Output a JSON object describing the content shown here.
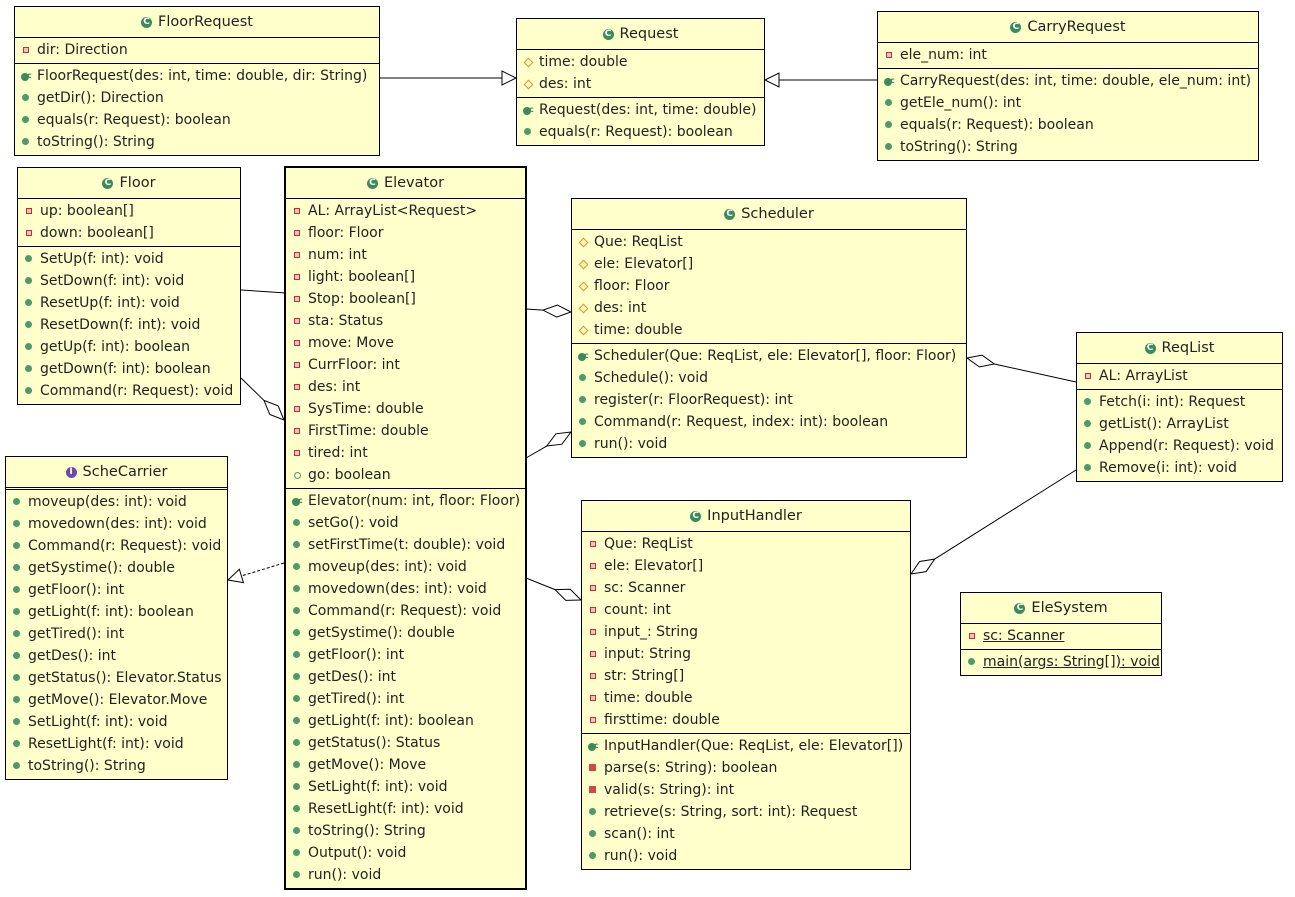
{
  "colors": {
    "class_fill": "#ffffcc",
    "border": "#000000",
    "public": "#4a9a6a",
    "private": "#c03030",
    "protected": "#c8a030",
    "interface": "#6a4aa8"
  },
  "classes": [
    {
      "id": "FloorRequest",
      "name": "FloorRequest",
      "kind": "class",
      "attributes": [
        {
          "vis": "private",
          "text": "dir: Direction"
        }
      ],
      "methods": [
        {
          "vis": "constructor",
          "text": "FloorRequest(des: int, time: double, dir: String)"
        },
        {
          "vis": "public",
          "text": "getDir(): Direction"
        },
        {
          "vis": "public",
          "text": "equals(r: Request): boolean"
        },
        {
          "vis": "public",
          "text": "toString(): String"
        }
      ]
    },
    {
      "id": "Request",
      "name": "Request",
      "kind": "class",
      "attributes": [
        {
          "vis": "protected",
          "text": "time: double"
        },
        {
          "vis": "protected",
          "text": "des: int"
        }
      ],
      "methods": [
        {
          "vis": "constructor",
          "text": "Request(des: int, time: double)"
        },
        {
          "vis": "public",
          "text": "equals(r: Request): boolean"
        }
      ]
    },
    {
      "id": "CarryRequest",
      "name": "CarryRequest",
      "kind": "class",
      "attributes": [
        {
          "vis": "private",
          "text": "ele_num: int"
        }
      ],
      "methods": [
        {
          "vis": "constructor",
          "text": "CarryRequest(des: int, time: double, ele_num: int)"
        },
        {
          "vis": "public",
          "text": "getEle_num(): int"
        },
        {
          "vis": "public",
          "text": "equals(r: Request): boolean"
        },
        {
          "vis": "public",
          "text": "toString(): String"
        }
      ]
    },
    {
      "id": "Floor",
      "name": "Floor",
      "kind": "class",
      "attributes": [
        {
          "vis": "private",
          "text": "up: boolean[]"
        },
        {
          "vis": "private",
          "text": "down: boolean[]"
        }
      ],
      "methods": [
        {
          "vis": "public",
          "text": "SetUp(f: int): void"
        },
        {
          "vis": "public",
          "text": "SetDown(f: int): void"
        },
        {
          "vis": "public",
          "text": "ResetUp(f: int): void"
        },
        {
          "vis": "public",
          "text": "ResetDown(f: int): void"
        },
        {
          "vis": "public",
          "text": "getUp(f: int): boolean"
        },
        {
          "vis": "public",
          "text": "getDown(f: int): boolean"
        },
        {
          "vis": "public",
          "text": "Command(r: Request): void"
        }
      ]
    },
    {
      "id": "Elevator",
      "name": "Elevator",
      "kind": "class",
      "selected": true,
      "attributes": [
        {
          "vis": "private",
          "text": "AL: ArrayList<Request>"
        },
        {
          "vis": "private",
          "text": "floor: Floor"
        },
        {
          "vis": "private",
          "text": "num: int"
        },
        {
          "vis": "private",
          "text": "light: boolean[]"
        },
        {
          "vis": "private",
          "text": "Stop: boolean[]"
        },
        {
          "vis": "private",
          "text": "sta: Status"
        },
        {
          "vis": "private",
          "text": "move: Move"
        },
        {
          "vis": "private",
          "text": "CurrFloor: int"
        },
        {
          "vis": "private",
          "text": "des: int"
        },
        {
          "vis": "private",
          "text": "SysTime: double"
        },
        {
          "vis": "private",
          "text": "FirstTime: double"
        },
        {
          "vis": "private",
          "text": "tired: int"
        },
        {
          "vis": "package",
          "text": "go: boolean"
        }
      ],
      "methods": [
        {
          "vis": "constructor",
          "text": "Elevator(num: int, floor: Floor)"
        },
        {
          "vis": "public",
          "text": "setGo(): void"
        },
        {
          "vis": "public",
          "text": "setFirstTime(t: double): void"
        },
        {
          "vis": "public",
          "text": "moveup(des: int): void"
        },
        {
          "vis": "public",
          "text": "movedown(des: int): void"
        },
        {
          "vis": "public",
          "text": "Command(r: Request): void"
        },
        {
          "vis": "public",
          "text": "getSystime(): double"
        },
        {
          "vis": "public",
          "text": "getFloor(): int"
        },
        {
          "vis": "public",
          "text": "getDes(): int"
        },
        {
          "vis": "public",
          "text": "getTired(): int"
        },
        {
          "vis": "public",
          "text": "getLight(f: int): boolean"
        },
        {
          "vis": "public",
          "text": "getStatus(): Status"
        },
        {
          "vis": "public",
          "text": "getMove(): Move"
        },
        {
          "vis": "public",
          "text": "SetLight(f: int): void"
        },
        {
          "vis": "public",
          "text": "ResetLight(f: int): void"
        },
        {
          "vis": "public",
          "text": "toString(): String"
        },
        {
          "vis": "public",
          "text": "Output(): void"
        },
        {
          "vis": "public",
          "text": "run(): void"
        }
      ]
    },
    {
      "id": "Scheduler",
      "name": "Scheduler",
      "kind": "class",
      "attributes": [
        {
          "vis": "protected",
          "text": "Que: ReqList"
        },
        {
          "vis": "protected",
          "text": "ele: Elevator[]"
        },
        {
          "vis": "protected",
          "text": "floor: Floor"
        },
        {
          "vis": "protected",
          "text": "des: int"
        },
        {
          "vis": "protected",
          "text": "time: double"
        }
      ],
      "methods": [
        {
          "vis": "constructor",
          "text": "Scheduler(Que: ReqList, ele: Elevator[], floor: Floor)"
        },
        {
          "vis": "public",
          "text": "Schedule(): void"
        },
        {
          "vis": "public",
          "text": "register(r: FloorRequest): int"
        },
        {
          "vis": "public",
          "text": "Command(r: Request, index: int): boolean"
        },
        {
          "vis": "public",
          "text": "run(): void"
        }
      ]
    },
    {
      "id": "ReqList",
      "name": "ReqList",
      "kind": "class",
      "attributes": [
        {
          "vis": "private",
          "text": "AL: ArrayList"
        }
      ],
      "methods": [
        {
          "vis": "public",
          "text": "Fetch(i: int): Request"
        },
        {
          "vis": "public",
          "text": "getList(): ArrayList"
        },
        {
          "vis": "public",
          "text": "Append(r: Request): void"
        },
        {
          "vis": "public",
          "text": "Remove(i: int): void"
        }
      ]
    },
    {
      "id": "ScheCarrier",
      "name": "ScheCarrier",
      "kind": "interface",
      "attributes": [],
      "methods": [
        {
          "vis": "public",
          "text": "moveup(des: int): void"
        },
        {
          "vis": "public",
          "text": "movedown(des: int): void"
        },
        {
          "vis": "public",
          "text": "Command(r: Request): void"
        },
        {
          "vis": "public",
          "text": "getSystime(): double"
        },
        {
          "vis": "public",
          "text": "getFloor(): int"
        },
        {
          "vis": "public",
          "text": "getLight(f: int): boolean"
        },
        {
          "vis": "public",
          "text": "getTired(): int"
        },
        {
          "vis": "public",
          "text": "getDes(): int"
        },
        {
          "vis": "public",
          "text": "getStatus(): Elevator.Status"
        },
        {
          "vis": "public",
          "text": "getMove(): Elevator.Move"
        },
        {
          "vis": "public",
          "text": "SetLight(f: int): void"
        },
        {
          "vis": "public",
          "text": "ResetLight(f: int): void"
        },
        {
          "vis": "public",
          "text": "toString(): String"
        }
      ]
    },
    {
      "id": "InputHandler",
      "name": "InputHandler",
      "kind": "class",
      "attributes": [
        {
          "vis": "private",
          "text": "Que: ReqList"
        },
        {
          "vis": "private",
          "text": "ele: Elevator[]"
        },
        {
          "vis": "private",
          "text": "sc: Scanner"
        },
        {
          "vis": "private",
          "text": "count: int"
        },
        {
          "vis": "private",
          "text": "input_: String"
        },
        {
          "vis": "private",
          "text": "input: String"
        },
        {
          "vis": "private",
          "text": "str: String[]"
        },
        {
          "vis": "private",
          "text": "time: double"
        },
        {
          "vis": "private",
          "text": "firsttime: double"
        }
      ],
      "methods": [
        {
          "vis": "constructor",
          "text": "InputHandler(Que: ReqList, ele: Elevator[])"
        },
        {
          "vis": "private-method",
          "text": "parse(s: String): boolean"
        },
        {
          "vis": "private-method",
          "text": "valid(s: String): int"
        },
        {
          "vis": "public",
          "text": "retrieve(s: String, sort: int): Request"
        },
        {
          "vis": "public",
          "text": "scan(): int"
        },
        {
          "vis": "public",
          "text": "run(): void"
        }
      ]
    },
    {
      "id": "EleSystem",
      "name": "EleSystem",
      "kind": "class",
      "attributes": [
        {
          "vis": "private",
          "text": "sc: Scanner",
          "static": true
        }
      ],
      "methods": [
        {
          "vis": "public",
          "text": "main(args: String[]): void",
          "static": true
        }
      ]
    }
  ],
  "relations": [
    {
      "from": "FloorRequest",
      "to": "Request",
      "type": "generalization"
    },
    {
      "from": "CarryRequest",
      "to": "Request",
      "type": "generalization"
    },
    {
      "from": "Floor",
      "to": "Scheduler",
      "type": "aggregation"
    },
    {
      "from": "Floor",
      "to": "Elevator",
      "type": "aggregation"
    },
    {
      "from": "Elevator",
      "to": "Scheduler",
      "type": "aggregation"
    },
    {
      "from": "Elevator",
      "to": "ScheCarrier",
      "type": "realization"
    },
    {
      "from": "Elevator",
      "to": "InputHandler",
      "type": "aggregation"
    },
    {
      "from": "ReqList",
      "to": "Scheduler",
      "type": "aggregation"
    },
    {
      "from": "ReqList",
      "to": "InputHandler",
      "type": "aggregation"
    }
  ]
}
